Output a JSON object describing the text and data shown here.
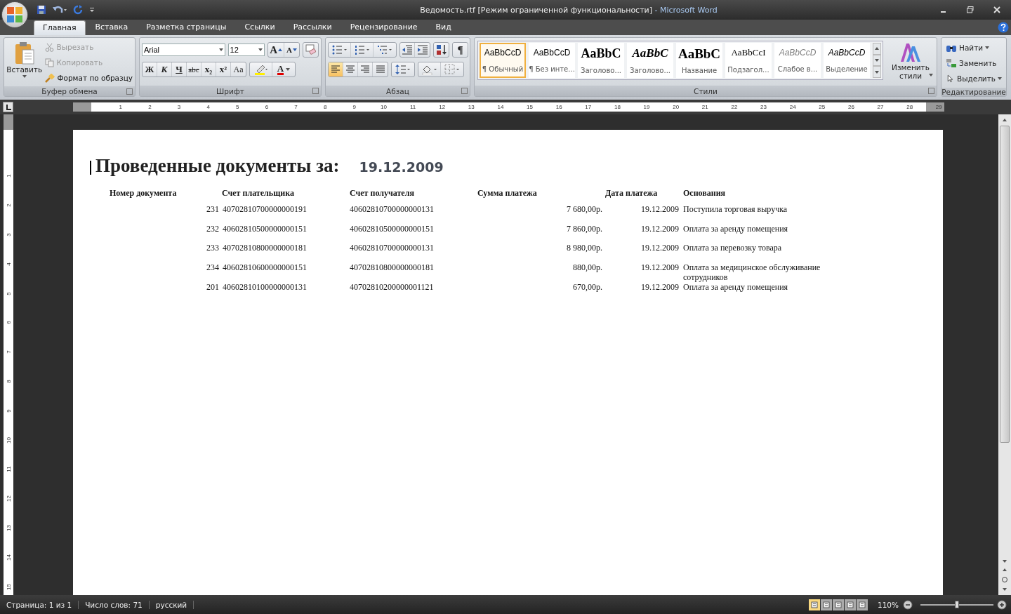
{
  "window": {
    "title": "Ведомость.rtf [Режим ограниченной функциональности]",
    "app": "- Microsoft Word"
  },
  "tabs": [
    {
      "label": "Главная",
      "selected": true
    },
    {
      "label": "Вставка",
      "selected": false
    },
    {
      "label": "Разметка страницы",
      "selected": false
    },
    {
      "label": "Ссылки",
      "selected": false
    },
    {
      "label": "Рассылки",
      "selected": false
    },
    {
      "label": "Рецензирование",
      "selected": false
    },
    {
      "label": "Вид",
      "selected": false
    }
  ],
  "clipboard": {
    "title": "Буфер обмена",
    "paste": "Вставить",
    "items": [
      {
        "label": "Вырезать",
        "disabled": true,
        "kind": "cut"
      },
      {
        "label": "Копировать",
        "disabled": true,
        "kind": "copy"
      },
      {
        "label": "Формат по образцу",
        "disabled": false,
        "kind": "brush"
      }
    ]
  },
  "font": {
    "title": "Шрифт",
    "family": "Arial",
    "size": "12",
    "grow": "A",
    "shrink": "A",
    "color_label": "A",
    "buttons": [
      {
        "label": "Ж",
        "kind": "bold"
      },
      {
        "label": "К",
        "kind": "italic"
      },
      {
        "label": "Ч",
        "kind": "underline"
      },
      {
        "label": "abc",
        "kind": "strike"
      },
      {
        "label": "x₂",
        "kind": "sub"
      },
      {
        "label": "x²",
        "kind": "sup"
      },
      {
        "label": "Aa",
        "kind": "case"
      }
    ]
  },
  "paragraph": {
    "title": "Абзац",
    "pilcrow": "¶",
    "alignment": [
      {
        "selected": true
      },
      {
        "selected": false
      },
      {
        "selected": false
      },
      {
        "selected": false
      }
    ]
  },
  "styles": {
    "title": "Стили",
    "change": "Изменить стили",
    "items": [
      {
        "sample": "AaBbCcD",
        "name": "¶ Обычный",
        "kind": "normal",
        "selected": true
      },
      {
        "sample": "AaBbCcD",
        "name": "¶ Без инте...",
        "kind": "normal",
        "selected": false
      },
      {
        "sample": "AaBbC",
        "name": "Заголово...",
        "kind": "heading1",
        "selected": false
      },
      {
        "sample": "AaBbC",
        "name": "Заголово...",
        "kind": "heading2",
        "selected": false
      },
      {
        "sample": "AaBbC",
        "name": "Название",
        "kind": "title",
        "selected": false
      },
      {
        "sample": "AaBbCcI",
        "name": "Подзагол...",
        "kind": "subtitle",
        "selected": false
      },
      {
        "sample": "AaBbCcD",
        "name": "Слабое в...",
        "kind": "subtle",
        "selected": false
      },
      {
        "sample": "AaBbCcD",
        "name": "Выделение",
        "kind": "emphasis",
        "selected": false
      }
    ]
  },
  "editing": {
    "title": "Редактирование",
    "find": "Найти",
    "replace": "Заменить",
    "select": "Выделить"
  },
  "ruler": {
    "marks": [
      "1",
      "2",
      "3",
      "4",
      "5",
      "6",
      "7",
      "8",
      "9",
      "10",
      "11",
      "12",
      "13",
      "14",
      "15",
      "16",
      "17",
      "18",
      "19",
      "20",
      "21",
      "22",
      "23",
      "24",
      "25",
      "26",
      "27",
      "28",
      "29"
    ]
  },
  "vertical_ruler": {
    "marks": [
      "1",
      "2",
      "3",
      "4",
      "5",
      "6",
      "7",
      "8",
      "9",
      "10",
      "11",
      "12",
      "13",
      "14",
      "15"
    ]
  },
  "document": {
    "title": "Проведенные документы за:",
    "date": "19.12.2009",
    "columns": [
      "Номер документа",
      "Счет плательщика",
      "Счет получателя",
      "Сумма платежа",
      "Дата платежа",
      "Основания"
    ],
    "rows": [
      [
        "231",
        "40702810700000000191",
        "40602810700000000131",
        "7 680,00р.",
        "19.12.2009",
        "Поступила торговая выручка"
      ],
      [
        "232",
        "40602810500000000151",
        "40602810500000000151",
        "7 860,00р.",
        "19.12.2009",
        "Оплата за аренду помещения"
      ],
      [
        "233",
        "40702810800000000181",
        "40602810700000000131",
        "8 980,00р.",
        "19.12.2009",
        "Оплата за перевозку товара"
      ],
      [
        "234",
        "40602810600000000151",
        "40702810800000000181",
        "880,00р.",
        "19.12.2009",
        "Оплата за медицинское обслуживание сотрудников"
      ],
      [
        "201",
        "40602810100000000131",
        "40702810200000001121",
        "670,00р.",
        "19.12.2009",
        "Оплата за аренду помещения"
      ]
    ]
  },
  "status_bar": {
    "page": "Страница: 1 из 1",
    "words": "Число слов: 71",
    "language": "русский",
    "zoom": "110%",
    "zoom_slider": {
      "level": 0.5
    },
    "views": [
      {
        "selected": true
      },
      {
        "selected": false
      },
      {
        "selected": false
      },
      {
        "selected": false
      },
      {
        "selected": false
      }
    ]
  }
}
